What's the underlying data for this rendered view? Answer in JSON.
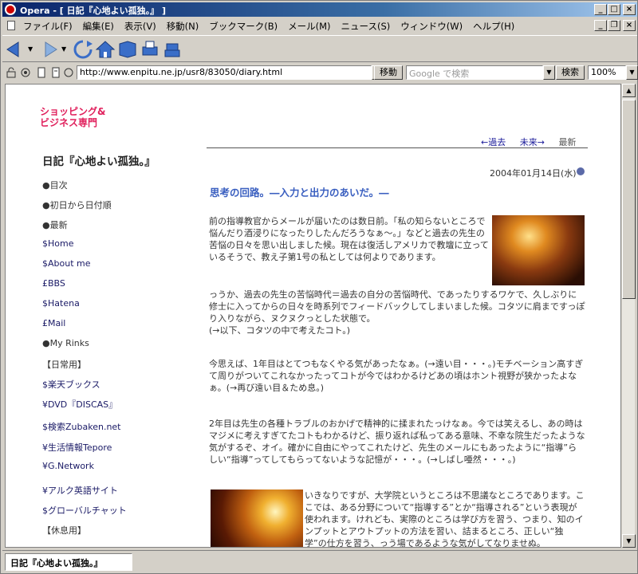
{
  "window": {
    "title": "Opera - [ 日記『心地よい孤独。』 ]"
  },
  "menu": {
    "items": [
      "ファイル(F)",
      "編集(E)",
      "表示(V)",
      "移動(N)",
      "ブックマーク(B)",
      "メール(M)",
      "ニュース(S)",
      "ウィンドウ(W)",
      "ヘルプ(H)"
    ]
  },
  "address": {
    "url": "http://www.enpitu.ne.jp/usr8/83050/diary.html",
    "go_label": "移動",
    "search_placeholder": "Google で検索",
    "search_label": "検索",
    "zoom": "100%"
  },
  "page": {
    "logo_line1": "ショッピング&",
    "logo_line2": "ビジネス専門",
    "site_title": "日記『心地よい孤独。』",
    "nav": [
      "●目次",
      "●初日から日付順",
      "●最新",
      "$Home",
      "$About me",
      "£BBS",
      "$Hatena",
      "£Mail",
      "●My Rinks",
      "【日常用】",
      "$楽天ブックス",
      "¥DVD『DISCAS』",
      "$検索Zubaken.net",
      "¥生活情報Tepore",
      "¥G.Network",
      "¥アルク英語サイト",
      "$グローバルチャット",
      "【休息用】"
    ],
    "pager_prev": "←過去",
    "pager_next": "未来→",
    "pager_latest": "最新",
    "date": "2004年01月14日(水)",
    "heading": "思考の回路。―入力と出力のあいだ。―",
    "para1": "前の指導教官からメールが届いたのは数日前。「私の知らないところで悩んだり酒浸りになったりしたんだろうなぁ〜。」などと過去の先生の苦悩の日々を思い出しました候。現在は復活しアメリカで教壇に立っているそうで、教え子第1号の私としては何よりであります。",
    "para2": "っうか、過去の先生の苦悩時代＝過去の自分の苦悩時代、であったりするワケで、久しぶりに修士に入ってからの日々を時系列でフィードバックしてしまいました候。コタツに肩まですっぽり入りながら、ヌクヌクっとした状態で。\n(→以下、コタツの中で考えたコト。)",
    "para3": "今思えば、1年目はとてつもなくやる気があったなぁ。(→遠い目・・・。)モチベーション高すぎて周りがついてこれなかったってコトが今ではわかるけどあの頃はホント視野が狭かったよなぁ。(→再び遠い目＆ため息。)",
    "para4": "2年目は先生の各種トラブルのおかげで精神的に揉まれたっけなぁ。今では笑えるし、あの時はマジメに考えすぎてたコトもわかるけど、振り返れば私ってある意味、不幸な院生だったような気がするぞ、オイ。確かに自由にやってこれたけど、先生のメールにもあったように“指導”らしい“指導”ってしてもらってないような記憶が・・・。(→しばし唖然・・・。)",
    "para5": "いきなりですが、大学院というところは不思議なところであります。ここでは、ある分野について“指導する”とか“指導される”という表現が使われます。けれども、実際のところは学び方を習う、つまり、知のインプットとアウトプットの方法を習い、詰まるところ、正しい“独学”の仕方を習う、っう場であるような気がしてなりませぬ。"
  },
  "status": {
    "tab_title": "日記『心地よい孤独。』"
  }
}
